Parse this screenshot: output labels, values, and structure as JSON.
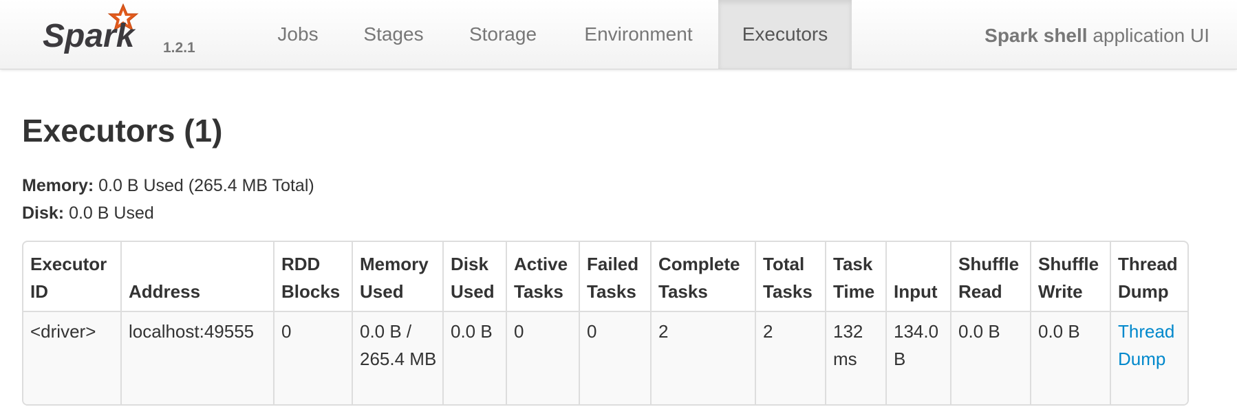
{
  "navbar": {
    "brand": {
      "logo_text": "Spark",
      "version": "1.2.1"
    },
    "tabs": [
      {
        "label": "Jobs"
      },
      {
        "label": "Stages"
      },
      {
        "label": "Storage"
      },
      {
        "label": "Environment"
      },
      {
        "label": "Executors",
        "active": true
      }
    ],
    "app_name": "Spark shell",
    "app_suffix": " application UI"
  },
  "page": {
    "title": "Executors (1)",
    "memory_label": "Memory:",
    "memory_value": " 0.0 B Used (265.4 MB Total)",
    "disk_label": "Disk:",
    "disk_value": " 0.0 B Used"
  },
  "table": {
    "headers": [
      [
        "Executor",
        "ID"
      ],
      [
        "",
        "Address"
      ],
      [
        "RDD",
        "Blocks"
      ],
      [
        "Memory",
        "Used"
      ],
      [
        "Disk",
        "Used"
      ],
      [
        "Active",
        "Tasks"
      ],
      [
        "Failed",
        "Tasks"
      ],
      [
        "Complete",
        "Tasks"
      ],
      [
        "Total",
        "Tasks"
      ],
      [
        "Task",
        "Time"
      ],
      [
        "",
        "Input"
      ],
      [
        "Shuffle",
        "Read"
      ],
      [
        "Shuffle",
        "Write"
      ],
      [
        "Thread",
        "Dump"
      ]
    ],
    "rows": [
      {
        "executor_id": "<driver>",
        "address": "localhost:49555",
        "rdd_blocks": "0",
        "memory_used": "0.0 B / 265.4 MB",
        "disk_used": "0.0 B",
        "active_tasks": "0",
        "failed_tasks": "0",
        "complete_tasks": "2",
        "total_tasks": "2",
        "task_time": "132 ms",
        "input": "134.0 B",
        "shuffle_read": "0.0 B",
        "shuffle_write": "0.0 B",
        "thread_dump": "Thread Dump"
      }
    ]
  },
  "colors": {
    "link": "#0088cc",
    "logo_orange": "#e25a1c",
    "logo_dark": "#3c3a3e"
  }
}
